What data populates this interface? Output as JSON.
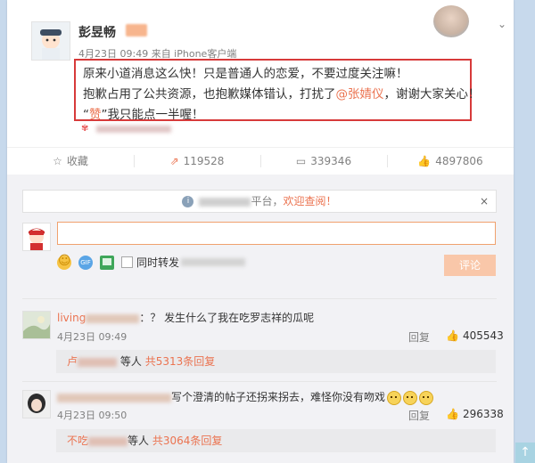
{
  "post": {
    "author": "彭昱畅",
    "meta": "4月23日 09:49 来自 iPhone客户端",
    "lines": {
      "l1": "原来小道消息这么快！只是普通人的恋爱，不要过度关注嘛！",
      "l2_a": "抱歉占用了公共资源，也抱歉媒体错认，打扰了",
      "l2_mention": "@张婧仪",
      "l2_b": "，谢谢大家关心！",
      "l3_a": "“",
      "l3_hl": "赞",
      "l3_b": "”我只能点一半喔！"
    }
  },
  "actions": {
    "favorite": {
      "icon": "☆",
      "label": "收藏"
    },
    "repost": {
      "icon": "⇗",
      "count": "119528"
    },
    "comment": {
      "icon": "▭",
      "count": "339346"
    },
    "like": {
      "icon": "👍",
      "count": "4897806"
    }
  },
  "notice": {
    "suffix": "平台，",
    "link": "欢迎查阅！",
    "close": "×"
  },
  "composer": {
    "placeholder": "",
    "repost_label": "同时转发",
    "submit": "评论"
  },
  "comments": [
    {
      "user": "living",
      "text": "：？ 发生什么了我在吃罗志祥的瓜呢",
      "time": "4月23日 09:49",
      "reply": "回复",
      "likes": "405543",
      "sub_user": "卢",
      "sub_tail": "等人",
      "sub_link": "共5313条回复"
    },
    {
      "user": "",
      "text": "写个澄清的帖子还拐来拐去，难怪你没有吻戏",
      "time": "4月23日 09:50",
      "reply": "回复",
      "likes": "296338",
      "sub_user": "不吃",
      "sub_tail": "等人",
      "sub_link": "共3064条回复"
    }
  ],
  "icons": {
    "chevron": "chevron-down-icon",
    "scroll_top": "↑"
  },
  "colors": {
    "accent": "#eb7350",
    "highlight_border": "#d73a3a",
    "background": "#c7d9ec"
  }
}
